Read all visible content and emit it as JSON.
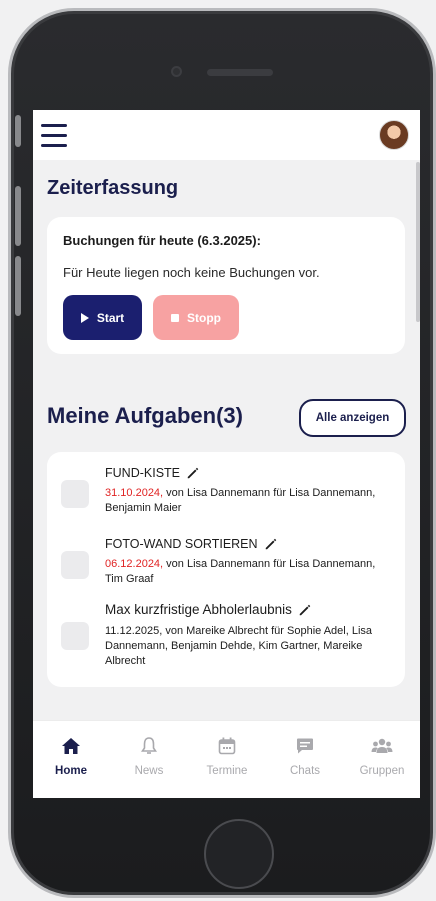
{
  "header": {
    "menu_icon": "hamburger-icon",
    "avatar_icon": "user-avatar"
  },
  "time_tracking": {
    "title": "Zeiterfassung",
    "bookings_title": "Buchungen für heute (6.3.2025):",
    "empty_text": "Für Heute liegen noch keine Buchungen vor.",
    "start_label": "Start",
    "stop_label": "Stopp"
  },
  "tasks": {
    "title": "Meine Aufgaben(3)",
    "show_all_label": "Alle anzeigen",
    "items": [
      {
        "name": "FUND-KISTE",
        "date": "31.10.2024,",
        "details": " von Lisa Dannemann für Lisa Dannemann, Benjamin Maier"
      },
      {
        "name": "FOTO-WAND SORTIEREN",
        "date": "06.12.2024,",
        "details": " von Lisa Dannemann für Lisa Dannemann, Tim Graaf"
      },
      {
        "name": "Max kurzfristige Abholerlaubnis",
        "date": "",
        "details": "11.12.2025, von Mareike Albrecht für Sophie Adel, Lisa Dannemann, Benjamin Dehde, Kim Gartner, Mareike Albrecht"
      }
    ]
  },
  "nav": {
    "items": [
      {
        "label": "Home",
        "icon": "home-icon",
        "active": true
      },
      {
        "label": "News",
        "icon": "bell-icon",
        "active": false
      },
      {
        "label": "Termine",
        "icon": "calendar-icon",
        "active": false
      },
      {
        "label": "Chats",
        "icon": "chat-icon",
        "active": false
      },
      {
        "label": "Gruppen",
        "icon": "groups-icon",
        "active": false
      }
    ]
  },
  "colors": {
    "primary": "#1b1f6f",
    "stop": "#f7a2a2",
    "date_red": "#e02424",
    "nav_inactive": "#a9a9ad"
  }
}
